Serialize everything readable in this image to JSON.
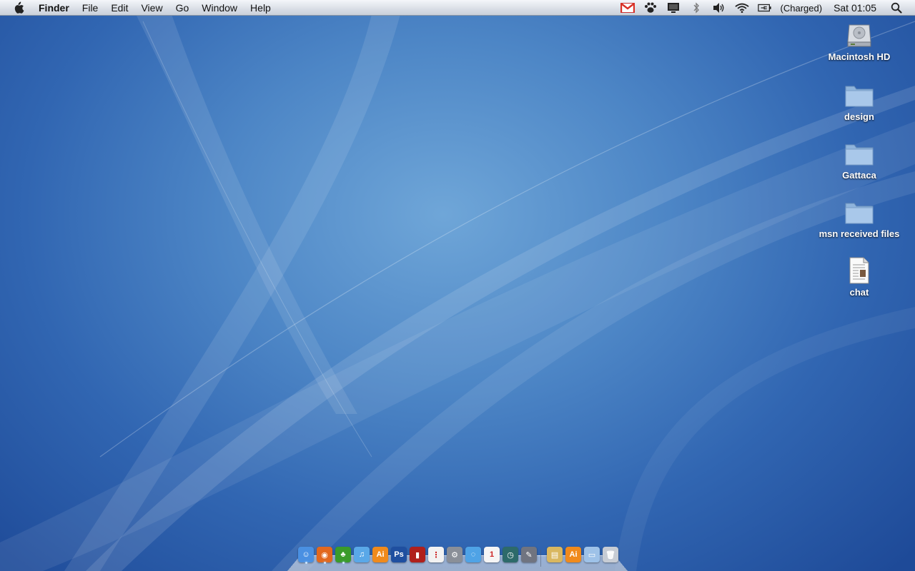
{
  "menubar": {
    "apple_icon": "apple-icon",
    "items": [
      {
        "label": "Finder",
        "bold": true
      },
      {
        "label": "File"
      },
      {
        "label": "Edit"
      },
      {
        "label": "View"
      },
      {
        "label": "Go"
      },
      {
        "label": "Window"
      },
      {
        "label": "Help"
      }
    ],
    "status": {
      "icons": [
        "gmail-icon",
        "paw-icon",
        "display-icon",
        "bluetooth-icon",
        "volume-icon",
        "wifi-icon",
        "battery-icon"
      ],
      "battery_text": "(Charged)",
      "clock": "Sat 01:05",
      "spotlight_icon": "spotlight-icon"
    }
  },
  "desktop": {
    "icons": [
      {
        "label": "Macintosh HD",
        "kind": "hard-drive-icon"
      },
      {
        "label": "design",
        "kind": "folder-icon"
      },
      {
        "label": "Gattaca",
        "kind": "folder-icon"
      },
      {
        "label": "msn received files",
        "kind": "folder-icon"
      },
      {
        "label": "chat",
        "kind": "document-icon"
      }
    ]
  },
  "dock": {
    "apps": [
      {
        "name": "finder-icon",
        "color": "#4a90e2",
        "glyph": "☺",
        "running": true
      },
      {
        "name": "firefox-icon",
        "color": "#e2681e",
        "glyph": "◉",
        "running": true
      },
      {
        "name": "adium-icon",
        "color": "#3a9b2a",
        "glyph": "♣",
        "running": true
      },
      {
        "name": "itunes-icon",
        "color": "#5aa8e8",
        "glyph": "♫",
        "running": false
      },
      {
        "name": "illustrator-icon",
        "color": "#f08a1c",
        "glyph": "Ai",
        "running": false
      },
      {
        "name": "photoshop-icon",
        "color": "#1f4fa0",
        "glyph": "Ps",
        "running": false
      },
      {
        "name": "red-app-icon",
        "color": "#b0201c",
        "glyph": "▮",
        "running": false
      },
      {
        "name": "text-edit-icon",
        "color": "#f2f2f2",
        "glyph": "⋮",
        "running": false
      },
      {
        "name": "system-preferences-icon",
        "color": "#8a8f98",
        "glyph": "⚙",
        "running": false
      },
      {
        "name": "ichat-icon",
        "color": "#4fa3e6",
        "glyph": "◌",
        "running": false
      },
      {
        "name": "ical-icon",
        "color": "#f5f5f5",
        "glyph": "1",
        "running": false
      },
      {
        "name": "time-machine-icon",
        "color": "#2d6a6a",
        "glyph": "◷",
        "running": false
      },
      {
        "name": "script-editor-icon",
        "color": "#707480",
        "glyph": "✎",
        "running": false
      }
    ],
    "others": [
      {
        "name": "applications-stack-icon",
        "color": "#d9b760",
        "glyph": "▤"
      },
      {
        "name": "documents-stack-icon",
        "color": "#f08a1c",
        "glyph": "Ai"
      },
      {
        "name": "downloads-folder-icon",
        "color": "#9ec2e8",
        "glyph": "▭"
      },
      {
        "name": "trash-icon",
        "color": "#c7ccd4",
        "glyph": "🗑"
      }
    ]
  }
}
